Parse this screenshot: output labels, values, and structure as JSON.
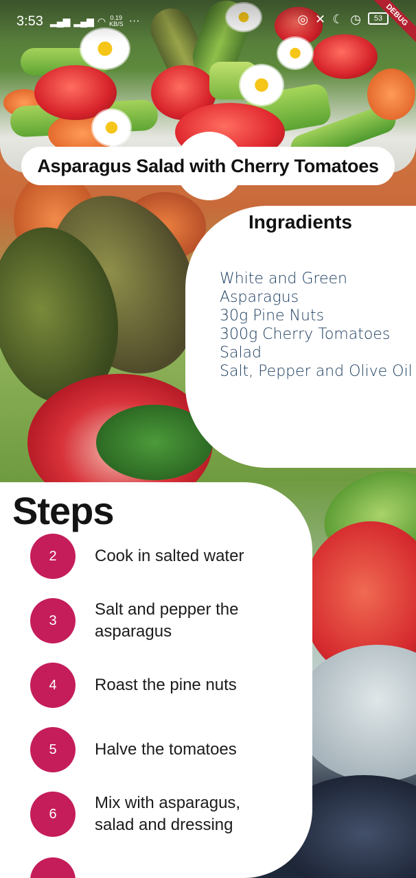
{
  "status_bar": {
    "time": "3:53",
    "net_speed_top": "0.19",
    "net_speed_bottom": "KB/S",
    "battery": "53",
    "debug_label": "DEBUG"
  },
  "recipe": {
    "title": "Asparagus Salad with Cherry Tomatoes"
  },
  "ingredients": {
    "heading": "Ingradients",
    "items": [
      "White and Green",
      "Asparagus",
      "30g Pine Nuts",
      "300g Cherry Tomatoes",
      "Salad",
      "Salt, Pepper and Olive Oil"
    ]
  },
  "steps": {
    "heading": "Steps",
    "items": [
      {
        "number": "2",
        "text": "Cook in salted water"
      },
      {
        "number": "3",
        "text": "Salt and pepper the asparagus"
      },
      {
        "number": "4",
        "text": "Roast the pine nuts"
      },
      {
        "number": "5",
        "text": "Halve the tomatoes"
      },
      {
        "number": "6",
        "text": "Mix with asparagus, salad and dressing"
      }
    ]
  },
  "colors": {
    "accent": "#c41d5a",
    "ingredient_text": "#1d3e60"
  }
}
